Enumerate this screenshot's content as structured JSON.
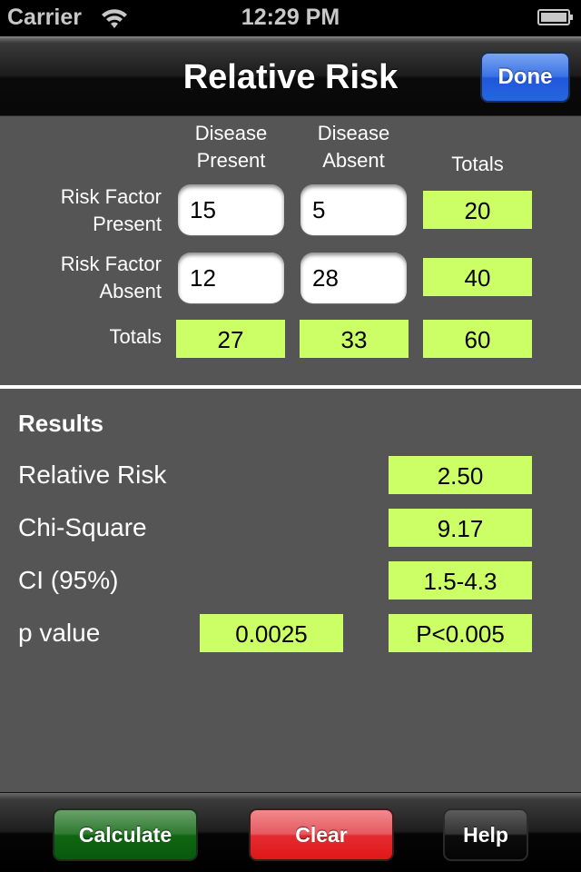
{
  "status_bar": {
    "carrier": "Carrier",
    "time": "12:29 PM",
    "wifi_icon": "wifi-icon",
    "battery_icon": "battery-icon"
  },
  "nav_bar": {
    "title": "Relative Risk",
    "done_label": "Done",
    "done_color": "#2a62df"
  },
  "table": {
    "column_headers": {
      "disease_present_1": "Disease",
      "disease_present_2": "Present",
      "disease_absent_1": "Disease",
      "disease_absent_2": "Absent",
      "totals": "Totals"
    },
    "rows": [
      {
        "label_1": "Risk Factor",
        "label_2": "Present",
        "disease_present": "15",
        "disease_absent": "5",
        "total": "20"
      },
      {
        "label_1": "Risk Factor",
        "label_2": "Absent",
        "disease_present": "12",
        "disease_absent": "28",
        "total": "40"
      }
    ],
    "totals_row": {
      "label": "Totals",
      "disease_present": "27",
      "disease_absent": "33",
      "grand_total": "60"
    },
    "output_color": "#ccff66"
  },
  "results": {
    "title": "Results",
    "relative_risk": {
      "label": "Relative Risk",
      "value": "2.50"
    },
    "chi_square": {
      "label": "Chi-Square",
      "value": "9.17"
    },
    "ci": {
      "label": "CI (95%)",
      "value": "1.5-4.3"
    },
    "p_value": {
      "label": "p value",
      "value": "0.0025",
      "threshold": "P<0.005"
    }
  },
  "toolbar": {
    "calculate_label": "Calculate",
    "clear_label": "Clear",
    "help_label": "Help",
    "calculate_color": "#1a6e1c",
    "clear_color": "#e32b30",
    "help_color": "#1a1a1a"
  }
}
